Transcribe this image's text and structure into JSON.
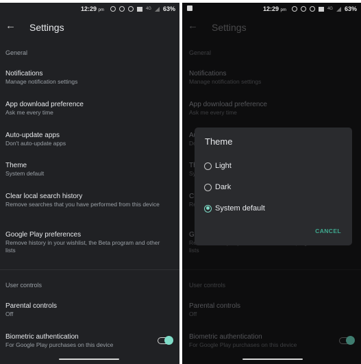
{
  "status_bar": {
    "time": "12:29",
    "time_suffix": "pm",
    "network": "4G",
    "battery": "63%"
  },
  "app_bar": {
    "title": "Settings",
    "back_icon": "arrow-back-icon"
  },
  "sections": {
    "general": "General",
    "user_controls": "User controls"
  },
  "items": [
    {
      "title": "Notifications",
      "subtitle": "Manage notification settings"
    },
    {
      "title": "App download preference",
      "subtitle": "Ask me every time"
    },
    {
      "title": "Auto-update apps",
      "subtitle": "Don't auto-update apps"
    },
    {
      "title": "Theme",
      "subtitle": "System default"
    },
    {
      "title": "Clear local search history",
      "subtitle": "Remove searches that you have performed from this device"
    },
    {
      "title": "Google Play preferences",
      "subtitle": "Remove history in your wishlist, the Beta program and other lists"
    },
    {
      "title": "Parental controls",
      "subtitle": "Off"
    },
    {
      "title": "Biometric authentication",
      "subtitle": "For Google Play purchases on this device",
      "toggle_on": true
    }
  ],
  "theme_dialog": {
    "title": "Theme",
    "options": [
      {
        "label": "Light",
        "selected": false
      },
      {
        "label": "Dark",
        "selected": false
      },
      {
        "label": "System default",
        "selected": true
      }
    ],
    "cancel_label": "CANCEL"
  },
  "colors": {
    "accent": "#7fdcc8",
    "cancel_text": "#3fa98f",
    "background_dark": "#202124"
  }
}
